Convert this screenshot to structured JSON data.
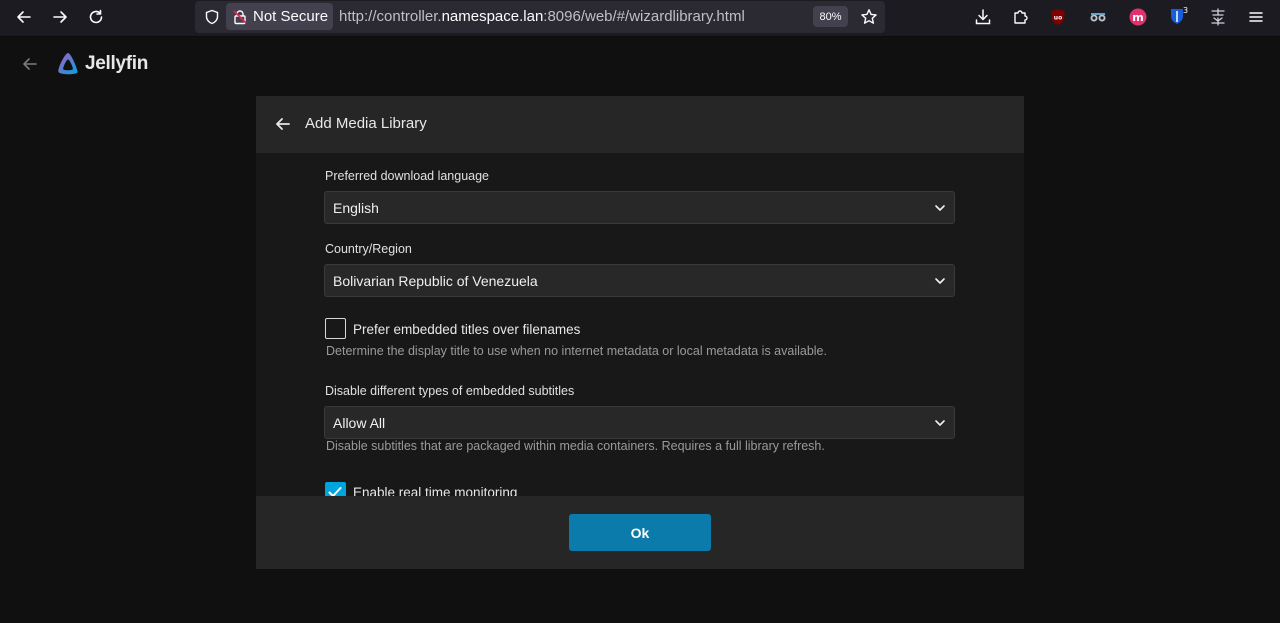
{
  "browser": {
    "security_label": "Not Secure",
    "url_prefix": "http://controller.",
    "url_host": "namespace.lan",
    "url_suffix": ":8096/web/#/wizardlibrary.html",
    "zoom": "80%",
    "ext_badge_count": "3"
  },
  "app": {
    "name": "Jellyfin",
    "accent": "#00a4dc"
  },
  "dialog": {
    "title": "Add Media Library",
    "fields": {
      "language_label": "Preferred download language",
      "language_value": "English",
      "country_label": "Country/Region",
      "country_value": "Bolivarian Republic of Venezuela",
      "embedded_titles_label": "Prefer embedded titles over filenames",
      "embedded_titles_help": "Determine the display title to use when no internet metadata or local metadata is available.",
      "subtitles_label": "Disable different types of embedded subtitles",
      "subtitles_value": "Allow All",
      "subtitles_help": "Disable subtitles that are packaged within media containers. Requires a full library refresh.",
      "realtime_label": "Enable real time monitoring"
    },
    "ok_label": "Ok"
  }
}
